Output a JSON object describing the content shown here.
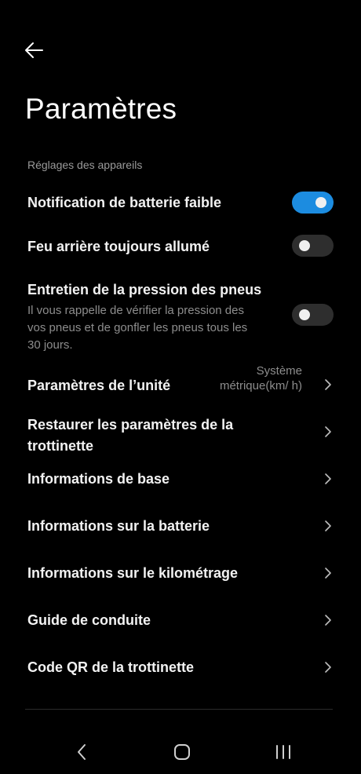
{
  "header": {
    "title": "Paramètres",
    "back_icon": "arrow-left-icon"
  },
  "section_label": "Réglages des appareils",
  "toggles": [
    {
      "label": "Notification de batterie faible",
      "on": true
    },
    {
      "label": "Feu arrière toujours allumé",
      "on": false
    },
    {
      "label": "Entretien de la pression des pneus",
      "description": "Il vous rappelle de vérifier la pression des vos pneus et de gonfler les pneus tous les 30 jours.",
      "on": false
    }
  ],
  "unit_settings": {
    "label": "Paramètres de l’unité",
    "value": "Système métrique(km/ h)"
  },
  "menu_items": [
    {
      "label": "Restaurer les paramètres de la trottinette"
    },
    {
      "label": "Informations de base"
    },
    {
      "label": "Informations sur la batterie"
    },
    {
      "label": "Informations sur le kilométrage"
    },
    {
      "label": "Guide de conduite"
    },
    {
      "label": "Code QR de la trottinette"
    }
  ],
  "nav_bar": {
    "back_icon": "back-chevron-icon",
    "home_icon": "home-icon",
    "recents_icon": "recents-icon"
  },
  "colors": {
    "background": "#000000",
    "toggle_on": "#1c8ce0",
    "toggle_off": "#2e2e2e",
    "secondary_text": "#8d8d8d"
  }
}
